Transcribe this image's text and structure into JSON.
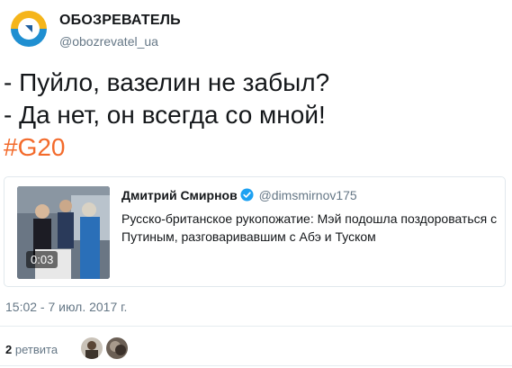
{
  "account": {
    "name": "ОБОЗРЕВАТЕЛЬ",
    "handle": "@obozrevatel_ua"
  },
  "tweet": {
    "lines": [
      "- Пуйло, вазелин не забыл?",
      "- Да нет, он всегда со мной!"
    ],
    "hashtag": "#G20",
    "timestamp": "15:02 - 7 июл. 2017 г."
  },
  "quoted_tweet": {
    "author_name": "Дмитрий Смирнов",
    "author_handle": "@dimsmirnov175",
    "text": "Русско-британское рукопожатие: Мэй подошла поздороваться с Путиным, разговаривавшим с Абэ и Туском",
    "video_duration": "0:03"
  },
  "stats": {
    "retweet_count": "2",
    "retweet_label": "ретвита"
  },
  "colors": {
    "hashtag": "#f36b2c",
    "verified": "#1da1f2",
    "secondary_text": "#657786"
  }
}
